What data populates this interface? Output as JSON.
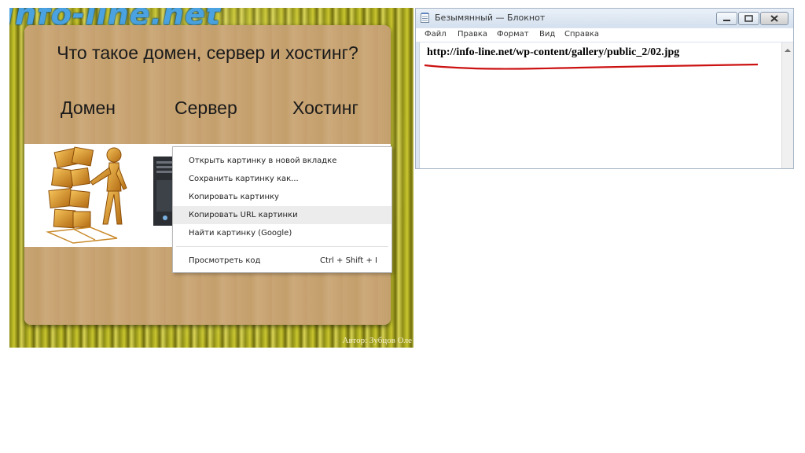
{
  "slide": {
    "logo_text": "Info-line.net",
    "title": "Что такое домен, сервер и хостинг?",
    "terms": [
      "Домен",
      "Сервер",
      "Хостинг"
    ],
    "author": "Автор: Зубцов Оле"
  },
  "context_menu": {
    "items": [
      {
        "label": "Открыть картинку в новой вкладке"
      },
      {
        "label": "Сохранить картинку как..."
      },
      {
        "label": "Копировать картинку"
      },
      {
        "label": "Копировать URL картинки",
        "highlighted": true
      },
      {
        "label": "Найти картинку (Google)"
      },
      {
        "label": "Просмотреть код",
        "shortcut": "Ctrl + Shift + I"
      }
    ]
  },
  "notepad": {
    "title": "Безымянный — Блокнот",
    "menu": [
      "Файл",
      "Правка",
      "Формат",
      "Вид",
      "Справка"
    ],
    "content": "http://info-line.net/wp-content/gallery/public_2/02.jpg",
    "underline_color": "#cc1111"
  },
  "colors": {
    "accent_blue": "#4aa3e0",
    "board": "#c9a575",
    "menu_highlight": "#ececec"
  }
}
